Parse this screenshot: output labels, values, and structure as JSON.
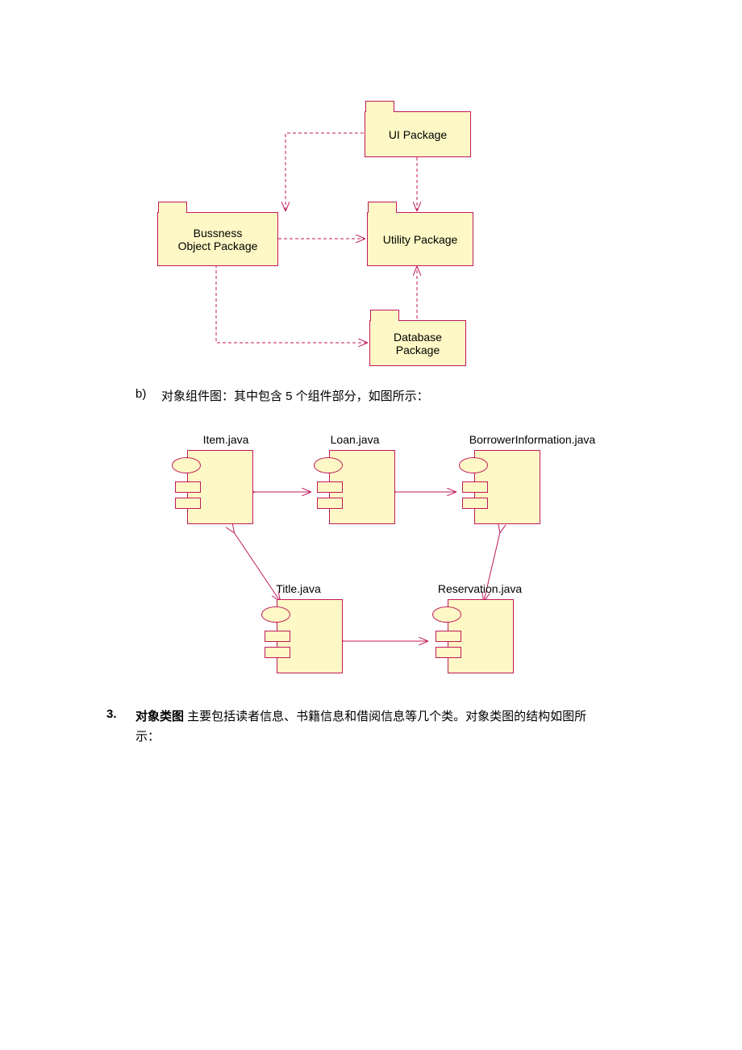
{
  "packages": {
    "ui": "UI Package",
    "util": "Utility Package",
    "bo_line1": "Bussness",
    "bo_line2": "Object Package",
    "db_line1": "Database",
    "db_line2": "Package"
  },
  "components": {
    "item": "Item.java",
    "loan": "Loan.java",
    "borrower": "BorrowerInformation.java",
    "title": "Title.java",
    "reservation": "Reservation.java"
  },
  "text": {
    "b": "b)",
    "b_desc": "对象组件图：其中包含 5 个组件部分，如图所示：",
    "n3": "3.",
    "n3_bold": "对象类图",
    "n3_rest": " 主要包括读者信息、书籍信息和借阅信息等几个类。对象类图的结构如图所",
    "n3_line2": "示："
  }
}
